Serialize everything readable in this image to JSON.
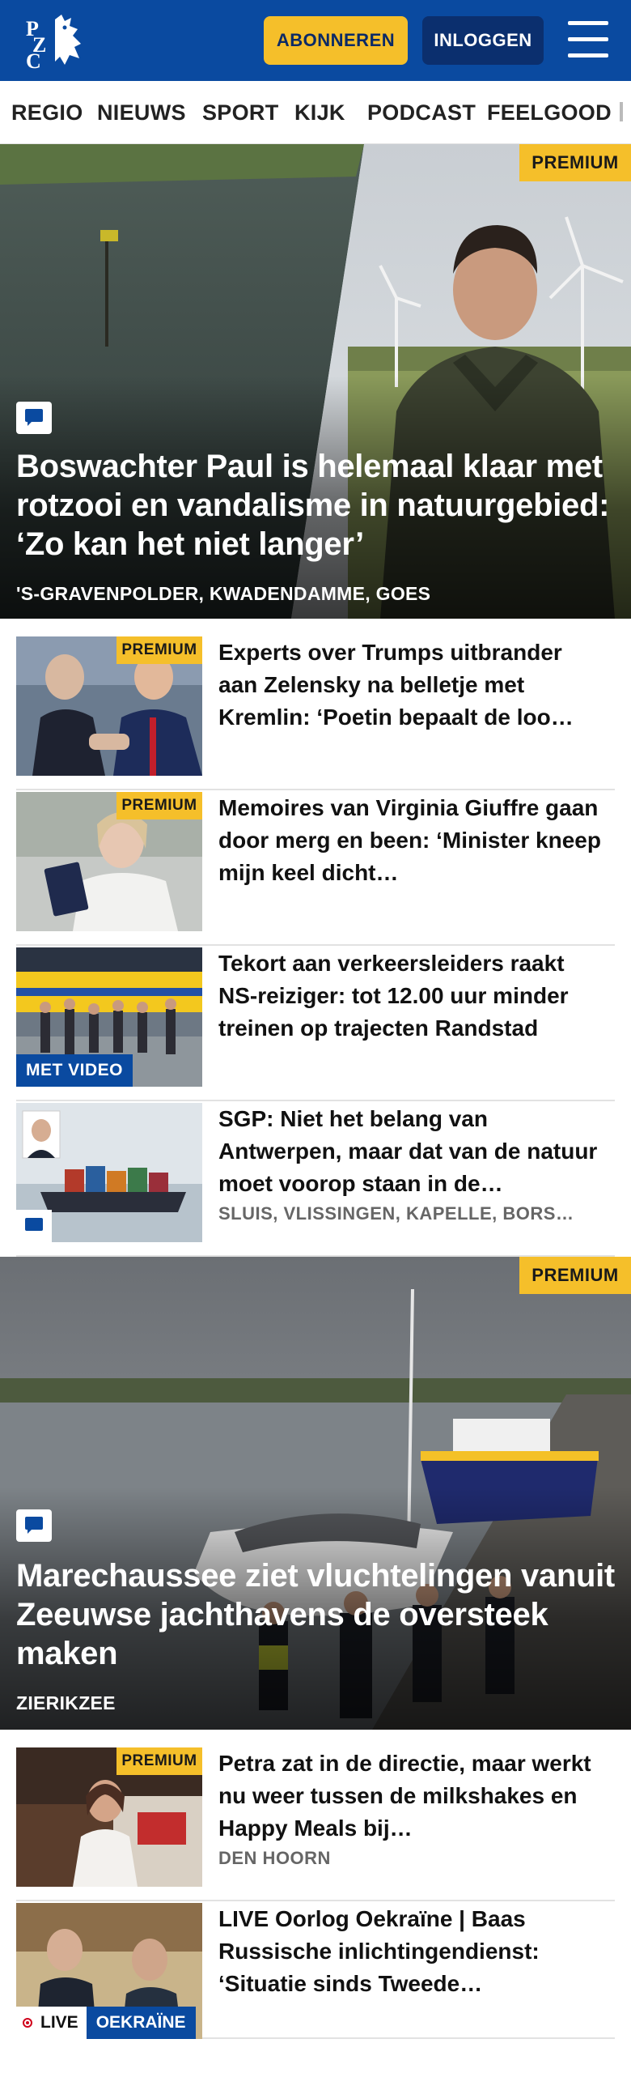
{
  "header": {
    "brand_color": "#0a4aa0",
    "logo_letters": "PZC",
    "subscribe_label": "ABONNEREN",
    "login_label": "INLOGGEN",
    "menu_icon": "hamburger-icon"
  },
  "nav": {
    "items": [
      "REGIO",
      "NIEUWS",
      "SPORT",
      "KIJK",
      "PODCAST",
      "FEELGOOD"
    ]
  },
  "badges": {
    "premium": "PREMIUM",
    "video": "MET VIDEO",
    "live": "LIVE"
  },
  "hero1": {
    "title": "Boswachter Paul is helemaal klaar met rotzooi en vandalisme in natuurgebied: ‘Zo kan het niet langer’",
    "location": "'S-GRAVENPOLDER, KWADENDAMME, GOES",
    "premium": true,
    "has_comments": true
  },
  "articles1": [
    {
      "title": "Experts over Trumps uitbrander aan Zelensky na belletje met Kremlin: ‘Poetin bepaalt de loo…",
      "premium": true
    },
    {
      "title": "Memoires van Virginia Giuffre gaan door merg en been: ‘Minister kneep mijn keel dicht…",
      "premium": true
    },
    {
      "title": "Tekort aan verkeersleiders raakt NS-reiziger: tot 12.00 uur minder treinen op trajecten Randstad",
      "video": true
    },
    {
      "title": "SGP: Niet het belang van Antwerpen, maar dat van de natuur moet voorop staan in de…",
      "location": "SLUIS, VLISSINGEN, KAPELLE, BORS…",
      "has_comments": true
    }
  ],
  "hero2": {
    "title": "Marechaussee ziet vluchtelingen vanuit Zeeuwse jachthavens de oversteek maken",
    "location": "ZIERIKZEE",
    "premium": true,
    "has_comments": true
  },
  "articles2": [
    {
      "title": "Petra zat in de directie, maar werkt nu weer tussen de milkshakes en Happy Meals bij…",
      "location": "DEN HOORN",
      "premium": true
    },
    {
      "title": "LIVE Oorlog Oekraïne | Baas Russische inlichtingendienst: ‘Situatie sinds Tweede…",
      "live_topic": "OEKRAÏNE"
    }
  ]
}
